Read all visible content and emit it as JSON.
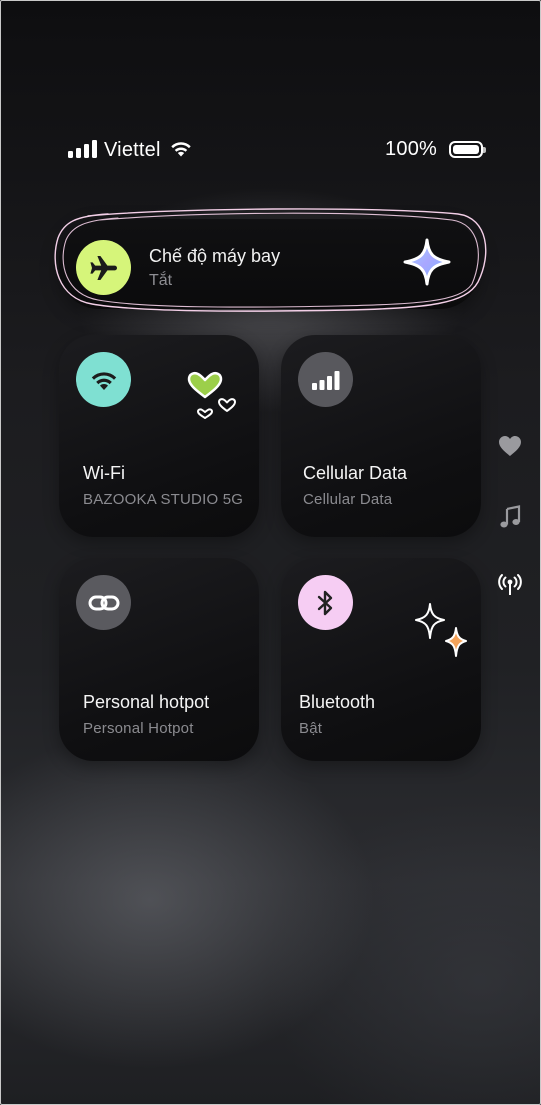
{
  "status_bar": {
    "carrier": "Viettel",
    "battery_text": "100%",
    "battery_level": 1.0,
    "icons": [
      "signal-bars-icon",
      "wifi-icon",
      "battery-icon"
    ]
  },
  "airplane_mode": {
    "title": "Chế độ máy bay",
    "state": "Tắt",
    "icon": "airplane-icon",
    "icon_bg": "#d6f57a",
    "decoration": "sparkle-icon"
  },
  "tiles": [
    {
      "id": "wifi",
      "title": "Wi-Fi",
      "subtitle": "BAZOOKA STUDIO 5G",
      "icon": "wifi-icon",
      "icon_bg": "#7fe0d2",
      "decoration": "hearts-sticker-icon"
    },
    {
      "id": "cellular",
      "title": "Cellular Data",
      "subtitle": "Cellular Data",
      "icon": "cellular-bars-icon",
      "icon_bg": "#58585d"
    },
    {
      "id": "hotspot",
      "title": "Personal hotpot",
      "subtitle": "Personal Hotpot",
      "icon": "link-icon",
      "icon_bg": "#5a5a5f"
    },
    {
      "id": "bluetooth",
      "title": "Bluetooth",
      "subtitle": "Bật",
      "icon": "bluetooth-icon",
      "icon_bg": "#f6cdf3",
      "decoration": "sparkles-sticker-icon"
    }
  ],
  "side_controls": [
    "heart-icon",
    "music-note-icon",
    "broadcast-icon"
  ]
}
